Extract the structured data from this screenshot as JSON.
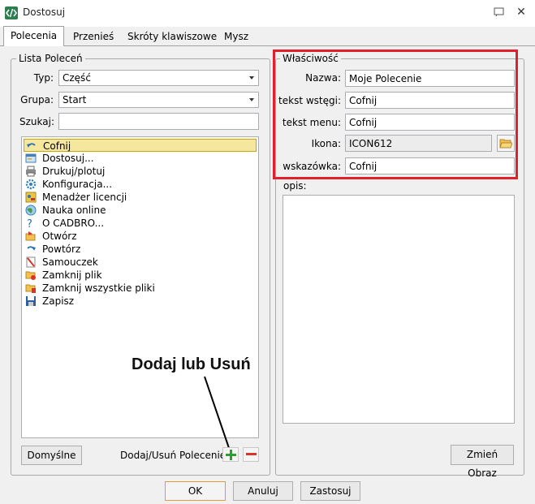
{
  "window": {
    "title": "Dostosuj",
    "close_glyph": "✕"
  },
  "tabs": [
    {
      "label": "Polecenia"
    },
    {
      "label": "Przenieś"
    },
    {
      "label": "Skróty klawiszowe"
    },
    {
      "label": "Mysz"
    }
  ],
  "commands_panel": {
    "legend": "Lista Poleceń",
    "type_label": "Typ:",
    "type_value": "Część",
    "group_label": "Grupa:",
    "group_value": "Start",
    "search_label": "Szukaj:",
    "search_value": "",
    "items": [
      {
        "label": "Cofnij",
        "icon": "undo-icon",
        "selected": true
      },
      {
        "label": "Dostosuj...",
        "icon": "customize-icon"
      },
      {
        "label": "Drukuj/plotuj",
        "icon": "printer-icon"
      },
      {
        "label": "Konfiguracja...",
        "icon": "gear-icon"
      },
      {
        "label": "Menadżer licencji",
        "icon": "license-icon"
      },
      {
        "label": "Nauka online",
        "icon": "globe-icon"
      },
      {
        "label": "O CADBRO...",
        "icon": "question-icon"
      },
      {
        "label": "Otwórz",
        "icon": "open-folder-icon"
      },
      {
        "label": "Powtórz",
        "icon": "redo-icon"
      },
      {
        "label": "Samouczek",
        "icon": "tutorial-icon"
      },
      {
        "label": "Zamknij plik",
        "icon": "close-file-icon"
      },
      {
        "label": "Zamknij wszystkie pliki",
        "icon": "close-all-files-icon"
      },
      {
        "label": "Zapisz",
        "icon": "save-icon"
      }
    ],
    "default_button": "Domyślne",
    "add_remove_label": "Dodaj/Usuń Polecenie:"
  },
  "annotation": {
    "text": "Dodaj lub Usuń"
  },
  "properties_panel": {
    "legend": "Właściwość",
    "name_label": "Nazwa:",
    "name_value": "Moje Polecenie",
    "ribbon_label": "tekst wstęgi:",
    "ribbon_value": "Cofnij",
    "menu_label": "tekst menu:",
    "menu_value": "Cofnij",
    "icon_label": "Ikona:",
    "icon_value": "ICON612",
    "tooltip_label": "wskazówka:",
    "tooltip_value": "Cofnij",
    "description_label": "opis:",
    "description_value": "",
    "change_image_button": "Zmień Obraz"
  },
  "footer": {
    "ok": "OK",
    "cancel": "Anuluj",
    "apply": "Zastosuj"
  },
  "colors": {
    "highlight_box": "#e0202a",
    "selection": "#f5e79e",
    "accent_ok": "#e29a3a"
  }
}
